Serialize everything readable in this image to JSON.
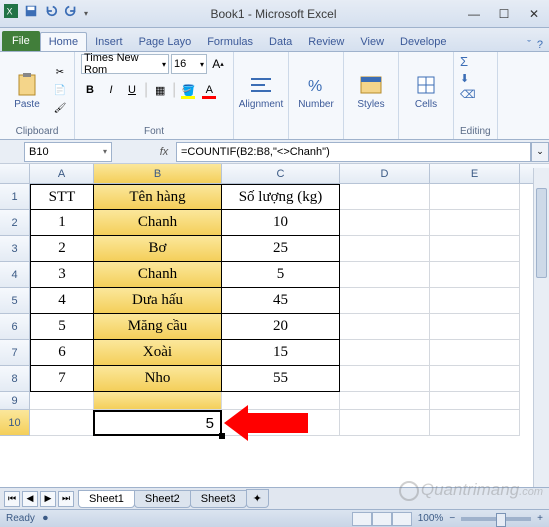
{
  "title": "Book1 - Microsoft Excel",
  "qat_icons": [
    "excel",
    "save",
    "undo",
    "redo",
    "print",
    "doc"
  ],
  "tabs": {
    "file": "File",
    "items": [
      "Home",
      "Insert",
      "Page Layo",
      "Formulas",
      "Data",
      "Review",
      "View",
      "Develope"
    ],
    "active": 0
  },
  "ribbon": {
    "clipboard": {
      "paste": "Paste",
      "label": "Clipboard"
    },
    "font": {
      "name": "Times New Rom",
      "size": "16",
      "label": "Font",
      "bold": "B",
      "italic": "I",
      "underline": "U"
    },
    "alignment": {
      "label": "Alignment"
    },
    "number": {
      "label": "Number",
      "pct": "%"
    },
    "styles": {
      "label": "Styles"
    },
    "cells": {
      "label": "Cells"
    },
    "editing": {
      "label": "Editing",
      "sigma": "Σ"
    }
  },
  "name_box": "B10",
  "fx": "fx",
  "formula": "=COUNTIF(B2:B8,\"<>Chanh\")",
  "columns": [
    "A",
    "B",
    "C",
    "D",
    "E"
  ],
  "rows": [
    "1",
    "2",
    "3",
    "4",
    "5",
    "6",
    "7",
    "8",
    "9",
    "10"
  ],
  "header": {
    "a": "STT",
    "b": "Tên hàng",
    "c": "Số lượng (kg)"
  },
  "data": [
    {
      "a": "1",
      "b": "Chanh",
      "c": "10"
    },
    {
      "a": "2",
      "b": "Bơ",
      "c": "25"
    },
    {
      "a": "3",
      "b": "Chanh",
      "c": "5"
    },
    {
      "a": "4",
      "b": "Dưa hấu",
      "c": "45"
    },
    {
      "a": "5",
      "b": "Măng cầu",
      "c": "20"
    },
    {
      "a": "6",
      "b": "Xoài",
      "c": "15"
    },
    {
      "a": "7",
      "b": "Nho",
      "c": "55"
    }
  ],
  "result": "5",
  "sheets": [
    "Sheet1",
    "Sheet2",
    "Sheet3"
  ],
  "active_sheet": 0,
  "status": "Ready",
  "zoom": "100%",
  "watermark": "Quantrimang"
}
